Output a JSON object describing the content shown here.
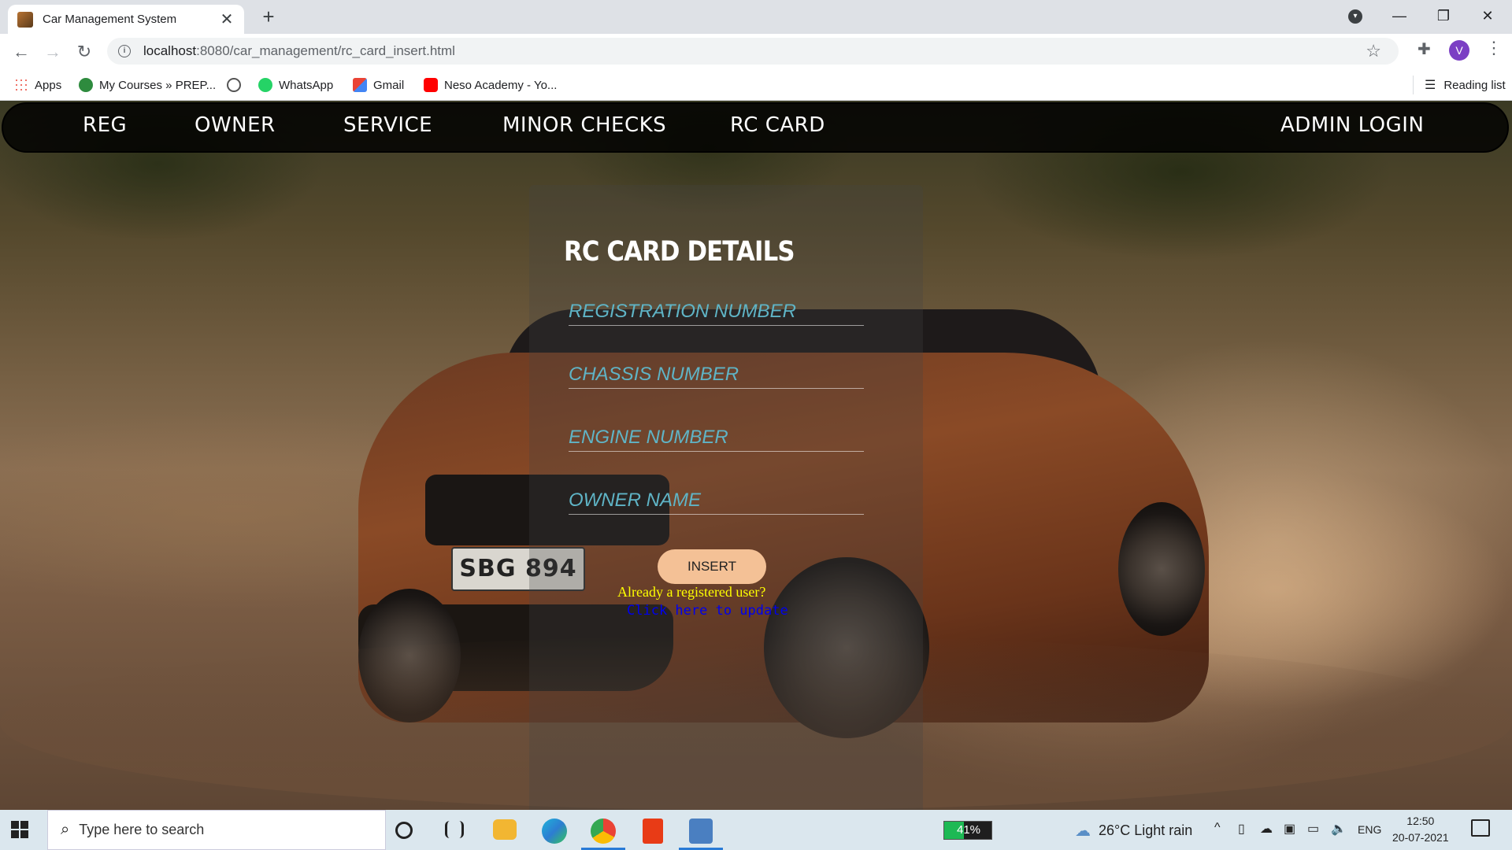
{
  "browser": {
    "tab_title": "Car Management System",
    "url_host": "localhost",
    "url_path": ":8080/car_management/rc_card_insert.html",
    "profile_initial": "V",
    "reading_list": "Reading list",
    "bookmarks": [
      "Apps",
      "My Courses » PREP...",
      "WhatsApp",
      "Gmail",
      "Neso Academy - Yo..."
    ]
  },
  "nav": {
    "items": [
      "REG",
      "OWNER",
      "SERVICE",
      "MINOR CHECKS",
      "RC CARD"
    ],
    "admin": "ADMIN LOGIN"
  },
  "car_plate": "SBG 894",
  "form": {
    "title": "RC CARD DETAILS",
    "fields": {
      "registration": "REGISTRATION NUMBER",
      "chassis": "CHASSIS NUMBER",
      "engine": "ENGINE NUMBER",
      "owner": "OWNER NAME"
    },
    "insert_label": "INSERT",
    "already": "Already a registered user?",
    "update_link": "Click here to update"
  },
  "taskbar": {
    "search_placeholder": "Type here to search",
    "battery_percent": 41,
    "battery_label": "41%",
    "weather": "26°C  Light rain",
    "lang": "ENG",
    "time": "12:50",
    "date": "20-07-2021"
  },
  "colors": {
    "field_text": "#5fb4c6",
    "button_bg": "#f4c196",
    "already_text": "#ffff00",
    "link_text": "#0000ee"
  },
  "icons": {
    "search": "search-icon",
    "extensions": "puzzle-icon",
    "bookmark": "star-icon"
  }
}
